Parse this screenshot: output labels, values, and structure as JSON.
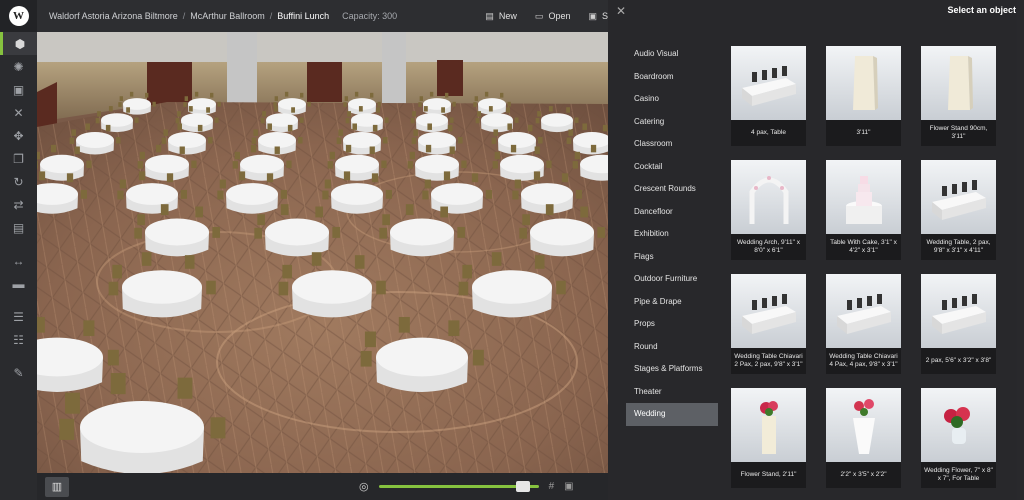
{
  "topbar": {
    "breadcrumbs": [
      "Waldorf Astoria Arizona Biltmore",
      "McArthur Ballroom",
      "Buffini Lunch"
    ],
    "capacity": "Capacity: 300",
    "new_label": "New",
    "open_label": "Open",
    "save_label": "S"
  },
  "toolbar": {
    "logo": "W",
    "tools": [
      {
        "name": "object-tool",
        "icon": "cube-icon",
        "glyph": "⬢",
        "active": true
      },
      {
        "name": "light-tool",
        "icon": "sun-icon",
        "glyph": "✺"
      },
      {
        "name": "select-tool",
        "icon": "bounding-box-icon",
        "glyph": "▣"
      },
      {
        "name": "delete-tool",
        "icon": "close-icon",
        "glyph": "✕"
      },
      {
        "name": "move-tool",
        "icon": "move-arrows-icon",
        "glyph": "✥"
      },
      {
        "name": "duplicate-tool",
        "icon": "copy-icon",
        "glyph": "❐"
      },
      {
        "name": "rotate-tool",
        "icon": "rotate-icon",
        "glyph": "↻"
      },
      {
        "name": "swap-tool",
        "icon": "swap-icon",
        "glyph": "⇄"
      },
      {
        "name": "trash-tool",
        "icon": "trash-icon",
        "glyph": "▤"
      },
      {
        "name": "measure-tool",
        "icon": "measure-icon",
        "glyph": "↔",
        "gap": true
      },
      {
        "name": "ruler-tool",
        "icon": "ruler-icon",
        "glyph": "▬"
      },
      {
        "name": "align-tool",
        "icon": "align-icon",
        "glyph": "☰",
        "gap": true
      },
      {
        "name": "distribute-tool",
        "icon": "distribute-icon",
        "glyph": "☷"
      },
      {
        "name": "edit-tool",
        "icon": "edit-icon",
        "glyph": "✎",
        "gap": true
      }
    ]
  },
  "viewport": {
    "zoom_level": 0.9
  },
  "panel": {
    "title": "Select an object",
    "categories": [
      "Audio Visual",
      "Boardroom",
      "Casino",
      "Catering",
      "Classroom",
      "Cocktail",
      "Crescent Rounds",
      "Dancefloor",
      "Exhibition",
      "Flags",
      "Outdoor Furniture",
      "Pipe & Drape",
      "Props",
      "Round",
      "Stages & Platforms",
      "Theater",
      "Wedding"
    ],
    "active_category": "Wedding",
    "objects": [
      {
        "label": "4 pax, Table",
        "icon": "head-table-icon"
      },
      {
        "label": "3'11\"",
        "icon": "pillar-icon"
      },
      {
        "label": "Flower Stand 90cm, 3'11\"",
        "icon": "pillar-icon"
      },
      {
        "label": "Wedding Arch, 9'11\" x 8'0\" x 6'1\"",
        "icon": "arch-icon"
      },
      {
        "label": "Table With Cake, 3'1\" x 4'2\" x 3'1\"",
        "icon": "cake-table-icon"
      },
      {
        "label": "Wedding Table, 2 pax, 9'8\" x 3'1\" x 4'11\"",
        "icon": "head-table-icon"
      },
      {
        "label": "Wedding Table Chiavari 2 Pax, 2 pax, 9'8\" x 3'1\"",
        "icon": "head-table-icon"
      },
      {
        "label": "Wedding Table Chiavari 4 Pax, 4 pax, 9'8\" x 3'1\"",
        "icon": "head-table-icon"
      },
      {
        "label": "2 pax, 5'6\" x 3'2\" x 3'8\"",
        "icon": "head-table-icon"
      },
      {
        "label": "Flower Stand, 2'11\"",
        "icon": "flower-stand-icon"
      },
      {
        "label": "2'2\" x 3'5\" x 2'2\"",
        "icon": "flower-table-icon"
      },
      {
        "label": "Wedding Flower, 7\" x 8\" x 7\", For Table",
        "icon": "flower-vase-icon"
      }
    ]
  },
  "bottombar": {
    "map_icon": "map-icon",
    "target_icon": "target-icon",
    "grid_icon": "grid-icon",
    "camera_icon": "camera-icon"
  },
  "colors": {
    "accent": "#86c23f",
    "carpet": "#8e6a52",
    "wall": "#a89472",
    "tablecloth": "#f4f4f4",
    "chair": "#7d6a3c"
  }
}
